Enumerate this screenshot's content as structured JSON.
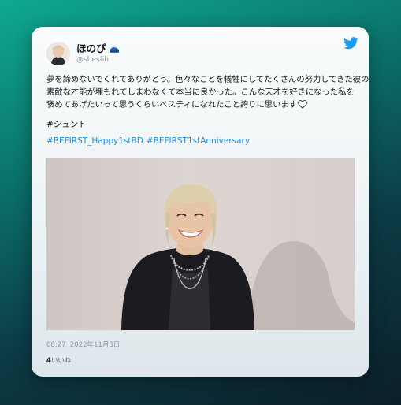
{
  "tweet": {
    "display_name": "ほのぴ",
    "handle": "@sbesfih",
    "text_lines": [
      "夢を諦めないでくれてありがとう。色々なことを犠牲にしてたくさんの努力してきた彼の",
      "素敵な才能が埋もれてしまわなくて本当に良かった。こんな天才を好きになった私を",
      "褒めてあげたいって思うくらいベスティになれたこと誇りに思います"
    ],
    "tag": "#シュント",
    "hashtags": [
      "#BEFIRST_Happy1stBD",
      "#BEFIRST1stAnniversary"
    ],
    "timestamp": "08:27 ·2022年11月3日",
    "likes_count": "4",
    "likes_label": "いいね"
  },
  "icons": {
    "brand": "twitter-bird-icon",
    "emoji": "blue-cap-emoji",
    "heart": "white-heart-icon"
  },
  "colors": {
    "twitter_blue": "#1d9bf0",
    "hashtag": "#1d8fe0",
    "text": "#14171a",
    "muted": "#8a98a3"
  }
}
